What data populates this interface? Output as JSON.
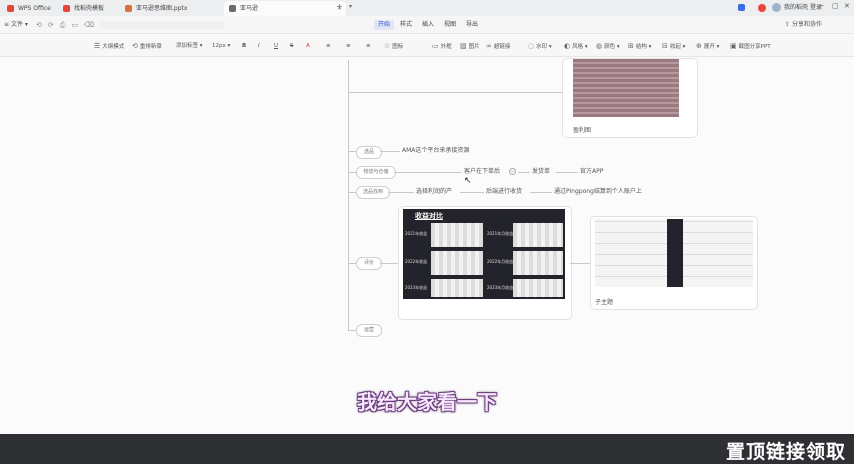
{
  "tabs": [
    {
      "label": "WPS Office",
      "color": "#e8463b"
    },
    {
      "label": "找稻壳模板",
      "color": "#e8463b"
    },
    {
      "label": "亚马逊思维图.pptx",
      "color": "#d9703a"
    },
    {
      "label": "亚马逊",
      "color": "#6b6b6b"
    }
  ],
  "titlebar_right": {
    "user": "我的稻壳",
    "login": "登录"
  },
  "menu": {
    "file": "文件",
    "tabs": [
      "开始",
      "样式",
      "插入",
      "视图",
      "导出"
    ],
    "share": "分享和协作"
  },
  "toolbar": [
    "大纲模式",
    "重排新章",
    "添加标签",
    "12px",
    "B",
    "I",
    "U",
    "S",
    "A",
    "图标",
    "链接",
    "外框",
    "图片",
    "超链接",
    "关系线",
    "水印",
    "风格",
    "颜色",
    "结构",
    "收起",
    "展开",
    "截图分享PPT"
  ],
  "mindmap": {
    "branches": [
      "选品",
      "物流与仓储",
      "选品找到",
      "评价",
      "运营"
    ],
    "ama_text": "AMA这个平台来承接资源",
    "flow": [
      "客户在下单后",
      "发货单",
      "官方APP"
    ],
    "row3": [
      "选择利润的产",
      "后端进行收货",
      "通过Pingpong结算到个人账户上"
    ],
    "card_top_label": "盈利图",
    "card_right_label": "子主题",
    "dark_card_title": "收益对比",
    "dark_rows": [
      "2021年收益",
      "2022年收益",
      "2023年收益"
    ],
    "dark_rows_right": [
      "2021年月收益",
      "2022年月收益",
      "2023年月收益"
    ]
  },
  "subtitle": "我给大家看一下",
  "banner": "置顶链接领取"
}
